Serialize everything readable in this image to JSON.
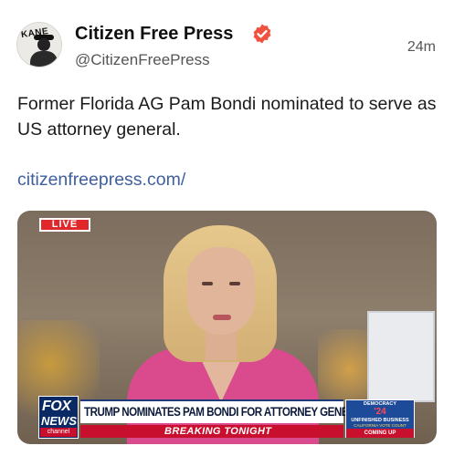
{
  "post": {
    "author_name": "Citizen Free Press",
    "handle": "@CitizenFreePress",
    "time": "24m",
    "text": "Former Florida AG Pam Bondi nominated to serve as US attorney general.",
    "link_text": "citizenfreepress.com/",
    "avatar_text": "KANE"
  },
  "media": {
    "live_label": "LIVE",
    "network_top": "FOX",
    "network_bottom": "NEWS",
    "network_sub": "channel",
    "headline": "TRUMP NOMINATES PAM BONDI FOR ATTORNEY GENERAL",
    "subline": "BREAKING TONIGHT",
    "promo_top": "DEMOCRACY",
    "promo_year": "'24",
    "promo_title": "UNFINISHED BUSINESS",
    "promo_sub": "CALIFORNIA VOTE COUNT",
    "promo_cta": "COMING UP"
  },
  "colors": {
    "verified": "#f0523f",
    "link": "#3f5f9f",
    "live": "#e0282b",
    "jacket": "#d94b8c",
    "breaking": "#c8102e"
  }
}
